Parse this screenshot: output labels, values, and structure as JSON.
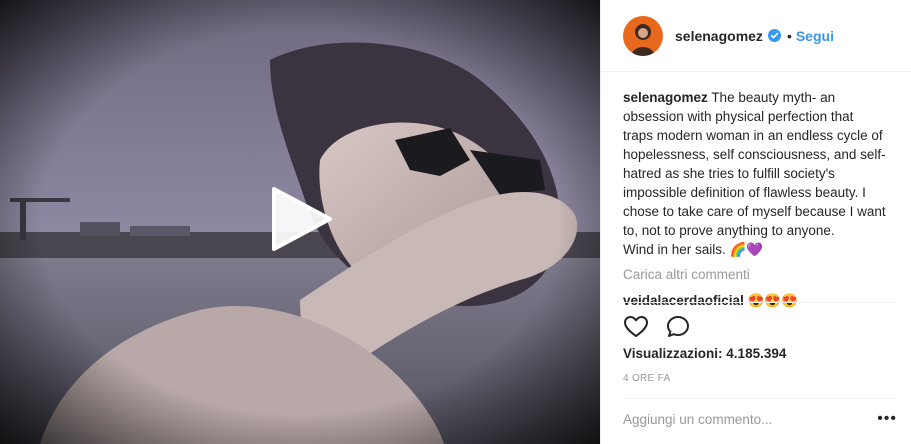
{
  "media": {
    "type": "video",
    "play_icon": "play-icon"
  },
  "header": {
    "username": "selenagomez",
    "verified_icon": "verified-badge-icon",
    "separator": "•",
    "follow_label": "Segui"
  },
  "caption": {
    "author": "selenagomez",
    "lines": [
      "The beauty myth- an",
      "obsession with physical perfection that",
      "traps modern woman in an endless cycle of",
      "hopelessness, self consciousness, and self-",
      "hatred as she tries to fulfill society's",
      "impossible definition of flawless beauty. I",
      "chose to take care of myself because I want",
      "to, not to prove anything to anyone.",
      "Wind in her sails. 🌈💜"
    ]
  },
  "load_more_label": "Carica altri commenti",
  "comments": [
    {
      "author": "veidalacerdaoficial",
      "text": "😍😍😍"
    }
  ],
  "actions": {
    "like_icon": "heart-icon",
    "comment_icon": "comment-icon"
  },
  "views": {
    "label": "Visualizzazioni:",
    "count": "4.185.394"
  },
  "timestamp": "4 ORE FA",
  "add_comment": {
    "placeholder": "Aggiungi un commento...",
    "more_label": "•••"
  },
  "colors": {
    "link_blue": "#3897f0",
    "muted": "#999999",
    "text": "#262626",
    "border": "#efefef"
  }
}
